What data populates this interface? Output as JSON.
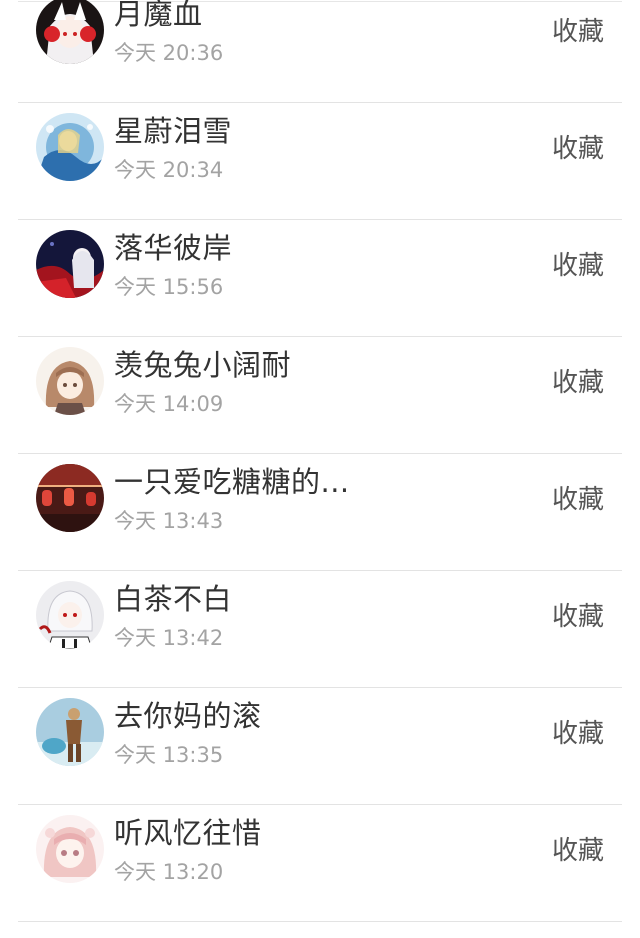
{
  "contacts": [
    {
      "name": "月魔血",
      "time": "今天 20:36",
      "action": "收藏",
      "avatar_icon": "anime-avatar-white-hair-red-headphones"
    },
    {
      "name": "星蔚泪雪",
      "time": "今天 20:34",
      "action": "收藏",
      "avatar_icon": "anime-avatar-blue-water"
    },
    {
      "name": "落华彼岸",
      "time": "今天 15:56",
      "action": "收藏",
      "avatar_icon": "anime-avatar-dark-red-night"
    },
    {
      "name": "羡兔兔小阔耐",
      "time": "今天 14:09",
      "action": "收藏",
      "avatar_icon": "anime-avatar-brown-hair-girl"
    },
    {
      "name": "一只爱吃糖糖的...",
      "time": "今天 13:43",
      "action": "收藏",
      "avatar_icon": "avatar-red-lanterns"
    },
    {
      "name": "白茶不白",
      "time": "今天 13:42",
      "action": "收藏",
      "avatar_icon": "anime-avatar-white-hair-boy"
    },
    {
      "name": "去你妈的滚",
      "time": "今天 13:35",
      "action": "收藏",
      "avatar_icon": "avatar-figure-sky"
    },
    {
      "name": "听风忆往惜",
      "time": "今天 13:20",
      "action": "收藏",
      "avatar_icon": "anime-avatar-pink-hair-girl"
    }
  ]
}
